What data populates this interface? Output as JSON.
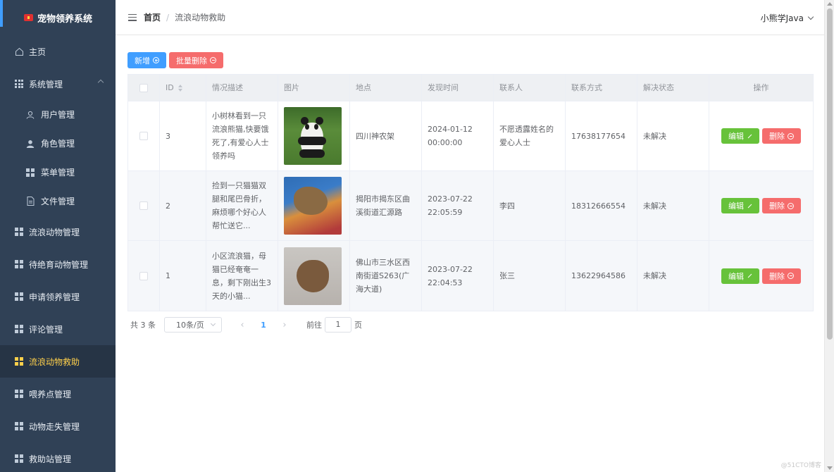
{
  "app": {
    "title": "宠物领养系统"
  },
  "sidebar": {
    "items": [
      {
        "label": "主页"
      },
      {
        "label": "系统管理"
      },
      {
        "label": "用户管理"
      },
      {
        "label": "角色管理"
      },
      {
        "label": "菜单管理"
      },
      {
        "label": "文件管理"
      },
      {
        "label": "流浪动物管理"
      },
      {
        "label": "待绝育动物管理"
      },
      {
        "label": "申请领养管理"
      },
      {
        "label": "评论管理"
      },
      {
        "label": "流浪动物救助"
      },
      {
        "label": "喂养点管理"
      },
      {
        "label": "动物走失管理"
      },
      {
        "label": "救助站管理"
      }
    ]
  },
  "header": {
    "breadcrumb_home": "首页",
    "breadcrumb_sep": "/",
    "breadcrumb_current": "流浪动物救助",
    "user": "小熊学Java"
  },
  "toolbar": {
    "add_label": "新增",
    "batch_delete_label": "批量删除"
  },
  "table": {
    "columns": [
      "ID",
      "情况描述",
      "图片",
      "地点",
      "发现时间",
      "联系人",
      "联系方式",
      "解决状态",
      "操作"
    ],
    "rows": [
      {
        "id": "3",
        "desc": "小树林看到一只流浪熊猫,快要饿死了,有爱心人士 领养吗",
        "location": "四川神农架",
        "time": "2024-01-12 00:00:00",
        "contact": "不愿透露姓名的爱心人士",
        "phone": "17638177654",
        "status": "未解决"
      },
      {
        "id": "2",
        "desc": "捡到一只猫猫双腿和尾巴骨折，麻烦哪个好心人帮忙送它...",
        "location": "揭阳市揭东区曲溪街道汇源路",
        "time": "2023-07-22 22:05:59",
        "contact": "李四",
        "phone": "18312666554",
        "status": "未解决"
      },
      {
        "id": "1",
        "desc": "小区流浪猫，母猫已经奄奄一息，剩下刚出生3天的小猫...",
        "location": "佛山市三水区西南街道S263(广海大道)",
        "time": "2023-07-22 22:04:53",
        "contact": "张三",
        "phone": "13622964586",
        "status": "未解决"
      }
    ],
    "edit_label": "编辑",
    "delete_label": "删除"
  },
  "pagination": {
    "total_text": "共 3 条",
    "page_size": "10条/页",
    "current_page": "1",
    "prev": "‹",
    "next": "›",
    "goto_label": "前往",
    "goto_value": "1",
    "page_suffix": "页"
  },
  "watermark": "@51CTO博客",
  "colors": {
    "sidebar_bg": "#304156",
    "active_text": "#ffd04b",
    "primary": "#409eff",
    "danger": "#f56c6c",
    "success": "#67c23a"
  }
}
